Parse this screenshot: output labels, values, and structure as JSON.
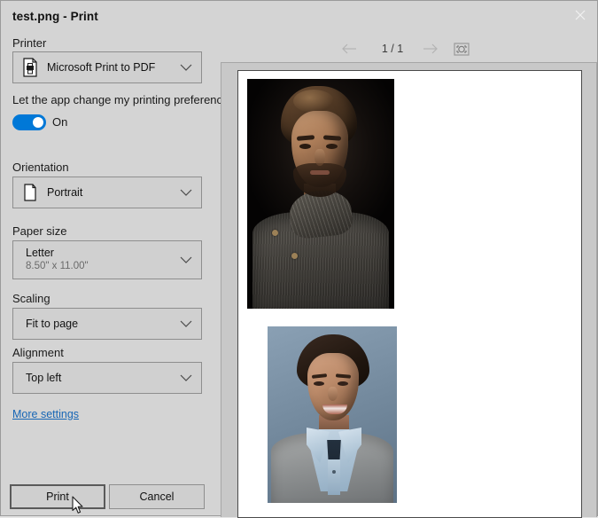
{
  "window": {
    "title": "test.png - Print",
    "close_icon": "close-icon"
  },
  "settings": {
    "printer": {
      "label": "Printer",
      "value": "Microsoft Print to PDF",
      "icon": "printer-icon",
      "chevron": "chevron-down-icon"
    },
    "preferences_toggle": {
      "label": "Let the app change my printing preferences",
      "state_label": "On",
      "state": "on",
      "accent_color": "#0078d7"
    },
    "orientation": {
      "label": "Orientation",
      "value": "Portrait",
      "icon": "page-portrait-icon",
      "chevron": "chevron-down-icon"
    },
    "paper_size": {
      "label": "Paper size",
      "value": "Letter",
      "dimensions": "8.50\" x 11.00\"",
      "chevron": "chevron-down-icon"
    },
    "scaling": {
      "label": "Scaling",
      "value": "Fit to page",
      "chevron": "chevron-down-icon"
    },
    "alignment": {
      "label": "Alignment",
      "value": "Top left",
      "chevron": "chevron-down-icon"
    },
    "more_settings_link": "More settings"
  },
  "actions": {
    "print_label": "Print",
    "cancel_label": "Cancel"
  },
  "preview": {
    "page_indicator": "1 / 1",
    "prev_icon": "arrow-left-icon",
    "next_icon": "arrow-right-icon",
    "fit_icon": "fit-to-page-icon",
    "paper_background": "#ffffff",
    "images": [
      {
        "name": "portrait-photo-dark",
        "description": "Man with brown hair and beard on black background wearing a dark gray knit shawl-collar sweater",
        "position": "top-left"
      },
      {
        "name": "portrait-photo-blue",
        "description": "Smiling man with dark hair on blue-gray background wearing a gray sweater over a light blue collared shirt",
        "position": "below-first"
      }
    ]
  },
  "cursor": {
    "icon": "mouse-pointer-icon",
    "over": "print-button"
  }
}
